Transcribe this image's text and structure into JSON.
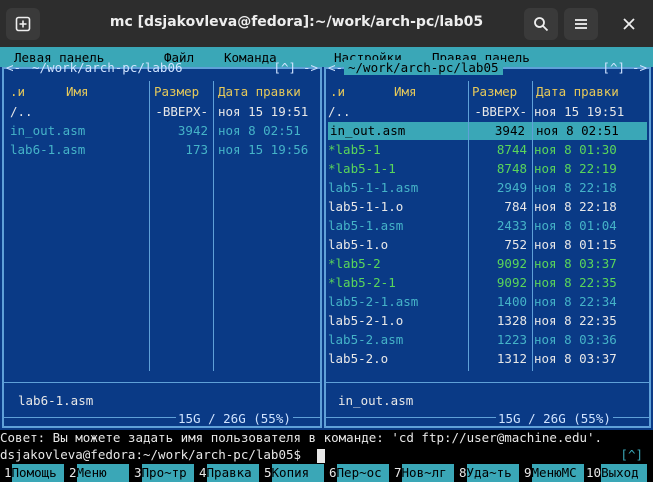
{
  "window": {
    "title": "mc [dsjakovleva@fedora]:~/work/arch-pc/lab05",
    "new_tab_icon": "plus-box-icon",
    "search_icon": "search-icon",
    "menu_icon": "hamburger-icon",
    "close_icon": "close-icon"
  },
  "menubar": [
    "Левая панель",
    "Файл",
    "Команда",
    "Настройки",
    "Правая панель"
  ],
  "left_panel": {
    "path": "~/work/arch-pc/lab06",
    "corner": "[^]",
    "left_corner": "<-",
    "right_corner": "->",
    "headers": {
      "sort": ".и",
      "name": "Имя",
      "size": "Размер",
      "date": "Дата правки"
    },
    "rows": [
      {
        "name": "/..",
        "size": "-ВВЕРХ-",
        "date": "ноя 15 19:51",
        "color": "white"
      },
      {
        "name": " in_out.asm",
        "size": "3942",
        "date": "ноя  8 02:51",
        "color": "cyan"
      },
      {
        "name": " lab6-1.asm",
        "size": "173",
        "date": "ноя 15 19:56",
        "color": "cyan"
      }
    ],
    "mini_status": "lab6-1.asm",
    "footer": "15G / 26G (55%)"
  },
  "right_panel": {
    "path": "~/work/arch-pc/lab05",
    "corner": "[^]",
    "left_corner": "<-",
    "right_corner": "->",
    "headers": {
      "sort": ".и",
      "name": "Имя",
      "size": "Размер",
      "date": "Дата правки"
    },
    "rows": [
      {
        "name": "/..",
        "size": "-ВВЕРХ-",
        "date": "ноя 15 19:51",
        "color": "white"
      },
      {
        "name": " in_out.asm",
        "size": "3942",
        "date": "ноя  8 02:51",
        "color": "selected"
      },
      {
        "name": "*lab5-1",
        "size": "8744",
        "date": "ноя  8 01:30",
        "color": "green"
      },
      {
        "name": "*lab5-1-1",
        "size": "8748",
        "date": "ноя  8 22:19",
        "color": "green"
      },
      {
        "name": " lab5-1-1.asm",
        "size": "2949",
        "date": "ноя  8 22:18",
        "color": "cyan"
      },
      {
        "name": " lab5-1-1.o",
        "size": "784",
        "date": "ноя  8 22:18",
        "color": "white"
      },
      {
        "name": " lab5-1.asm",
        "size": "2433",
        "date": "ноя  8 01:04",
        "color": "cyan"
      },
      {
        "name": " lab5-1.o",
        "size": "752",
        "date": "ноя  8 01:15",
        "color": "white"
      },
      {
        "name": "*lab5-2",
        "size": "9092",
        "date": "ноя  8 03:37",
        "color": "green"
      },
      {
        "name": "*lab5-2-1",
        "size": "9092",
        "date": "ноя  8 22:35",
        "color": "green"
      },
      {
        "name": " lab5-2-1.asm",
        "size": "1400",
        "date": "ноя  8 22:34",
        "color": "cyan"
      },
      {
        "name": " lab5-2-1.o",
        "size": "1328",
        "date": "ноя  8 22:35",
        "color": "white"
      },
      {
        "name": " lab5-2.asm",
        "size": "1223",
        "date": "ноя  8 03:36",
        "color": "cyan"
      },
      {
        "name": " lab5-2.o",
        "size": "1312",
        "date": "ноя  8 03:37",
        "color": "white"
      }
    ],
    "mini_status": "in_out.asm",
    "footer": "15G / 26G (55%)"
  },
  "hint": "Совет: Вы можете задать имя пользователя в команде: 'cd ftp://user@machine.edu'.",
  "prompt": "dsjakovleva@fedora:~/work/arch-pc/lab05$",
  "prompt_corner": "[^]",
  "fkeys": [
    {
      "num": "1",
      "label": "Помощь"
    },
    {
      "num": "2",
      "label": "Меню"
    },
    {
      "num": "3",
      "label": "Про~тр"
    },
    {
      "num": "4",
      "label": "Правка"
    },
    {
      "num": "5",
      "label": "Копия"
    },
    {
      "num": "6",
      "label": "Пер~ос"
    },
    {
      "num": "7",
      "label": "Нов~лг"
    },
    {
      "num": "8",
      "label": "Уда~ть"
    },
    {
      "num": "9",
      "label": "МенюМС"
    },
    {
      "num": "10",
      "label": "Выход"
    }
  ],
  "colors": {
    "panel_bg": "#0a3a86",
    "accent": "#3aa7b7",
    "header": "#e6c95a",
    "exec": "#5ad65a",
    "source": "#45b3c8"
  }
}
